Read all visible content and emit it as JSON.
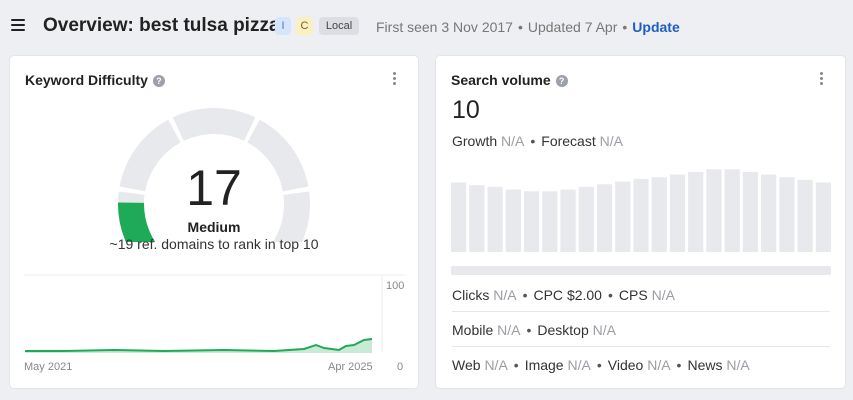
{
  "header": {
    "title": "Overview: best tulsa pizza",
    "badges": {
      "i": "I",
      "c": "C",
      "local": "Local"
    },
    "first_seen": "First seen 3 Nov 2017",
    "updated": "Updated 7 Apr",
    "separator": "•",
    "update_label": "Update"
  },
  "icons": {
    "menu": "hamburger-menu-icon",
    "help": "question-circle-icon",
    "more": "vertical-dots-icon"
  },
  "colors": {
    "accent_link": "#1c5ec2",
    "gauge_fill": "#1faa58",
    "gauge_track": "#e8e9ec",
    "trend_line": "#1faa58",
    "trend_fill": "#c9ebd6",
    "bar": "#e8e9ec"
  },
  "keyword_difficulty": {
    "title": "Keyword Difficulty",
    "help_glyph": "?",
    "score": "17",
    "score_value": 17,
    "level": "Medium",
    "description": "~19 ref. domains to rank in top 10",
    "history": {
      "y_max_label": "100",
      "y_min_label": "0",
      "x_start_label": "May 2021",
      "x_end_label": "Apr 2025"
    }
  },
  "search_volume": {
    "title": "Search volume",
    "help_glyph": "?",
    "value": "10",
    "growth": {
      "label": "Growth",
      "value": "N/A"
    },
    "forecast": {
      "label": "Forecast",
      "value": "N/A"
    },
    "clicks": {
      "label": "Clicks",
      "value": "N/A"
    },
    "cpc": {
      "label": "CPC",
      "value": "$2.00"
    },
    "cps": {
      "label": "CPS",
      "value": "N/A"
    },
    "mobile": {
      "label": "Mobile",
      "value": "N/A"
    },
    "desktop": {
      "label": "Desktop",
      "value": "N/A"
    },
    "web": {
      "label": "Web",
      "value": "N/A"
    },
    "image": {
      "label": "Image",
      "value": "N/A"
    },
    "video": {
      "label": "Video",
      "value": "N/A"
    },
    "news": {
      "label": "News",
      "value": "N/A"
    },
    "bars": [
      0.79,
      0.76,
      0.74,
      0.71,
      0.69,
      0.69,
      0.71,
      0.74,
      0.77,
      0.8,
      0.83,
      0.85,
      0.88,
      0.91,
      0.94,
      0.94,
      0.91,
      0.88,
      0.85,
      0.82,
      0.79
    ]
  }
}
